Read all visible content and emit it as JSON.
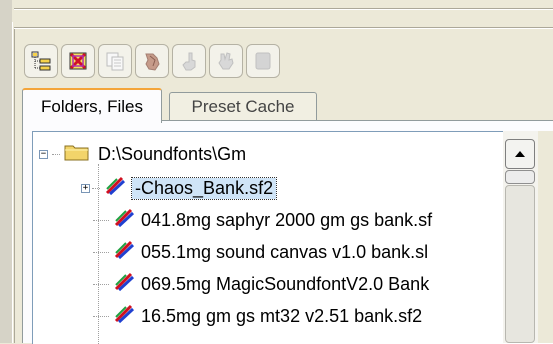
{
  "tabs": [
    {
      "label": "Folders, Files",
      "active": true
    },
    {
      "label": "Preset Cache",
      "active": false
    }
  ],
  "toolbar": {
    "buttons": [
      {
        "name": "tree-view-icon",
        "enabled": true
      },
      {
        "name": "delete-icon",
        "enabled": true
      },
      {
        "name": "copy-icon",
        "enabled": false
      },
      {
        "name": "hand-icon",
        "enabled": false
      },
      {
        "name": "hand-up-icon",
        "enabled": false
      },
      {
        "name": "hand-spread-icon",
        "enabled": false
      },
      {
        "name": "blank-icon",
        "enabled": false
      }
    ]
  },
  "tree": {
    "root": {
      "label": "D:\\Soundfonts\\Gm",
      "expanded": true,
      "icon": "folder-icon"
    },
    "items": [
      {
        "label": "-Chaos_Bank.sf2",
        "selected": true,
        "expandable": true,
        "icon": "soundfont-icon"
      },
      {
        "label": "041.8mg saphyr 2000 gm gs bank.sf",
        "selected": false,
        "expandable": false,
        "icon": "soundfont-icon"
      },
      {
        "label": "055.1mg sound canvas v1.0 bank.sl",
        "selected": false,
        "expandable": false,
        "icon": "soundfont-icon"
      },
      {
        "label": "069.5mg MagicSoundfontV2.0 Bank",
        "selected": false,
        "expandable": false,
        "icon": "soundfont-icon"
      },
      {
        "label": "16.5mg gm gs mt32 v2.51 bank.sf2",
        "selected": false,
        "expandable": false,
        "icon": "soundfont-icon"
      }
    ]
  },
  "colors": {
    "window_bg": "#ece9d8",
    "tab_accent": "#f4a53a",
    "tree_border": "#7f9db9",
    "selection_bg": "#cfe4f7"
  }
}
